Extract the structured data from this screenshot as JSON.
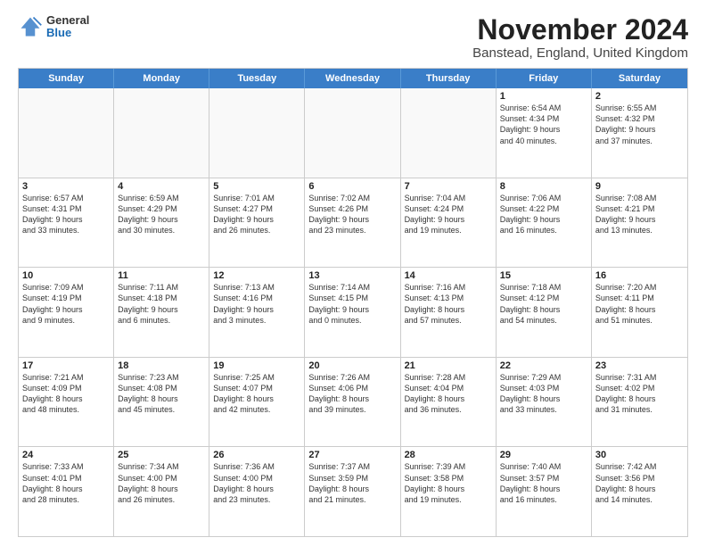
{
  "logo": {
    "general": "General",
    "blue": "Blue"
  },
  "title": "November 2024",
  "location": "Banstead, England, United Kingdom",
  "header_days": [
    "Sunday",
    "Monday",
    "Tuesday",
    "Wednesday",
    "Thursday",
    "Friday",
    "Saturday"
  ],
  "rows": [
    [
      {
        "day": "",
        "info": "",
        "empty": true
      },
      {
        "day": "",
        "info": "",
        "empty": true
      },
      {
        "day": "",
        "info": "",
        "empty": true
      },
      {
        "day": "",
        "info": "",
        "empty": true
      },
      {
        "day": "",
        "info": "",
        "empty": true
      },
      {
        "day": "1",
        "info": "Sunrise: 6:54 AM\nSunset: 4:34 PM\nDaylight: 9 hours\nand 40 minutes.",
        "empty": false
      },
      {
        "day": "2",
        "info": "Sunrise: 6:55 AM\nSunset: 4:32 PM\nDaylight: 9 hours\nand 37 minutes.",
        "empty": false
      }
    ],
    [
      {
        "day": "3",
        "info": "Sunrise: 6:57 AM\nSunset: 4:31 PM\nDaylight: 9 hours\nand 33 minutes.",
        "empty": false
      },
      {
        "day": "4",
        "info": "Sunrise: 6:59 AM\nSunset: 4:29 PM\nDaylight: 9 hours\nand 30 minutes.",
        "empty": false
      },
      {
        "day": "5",
        "info": "Sunrise: 7:01 AM\nSunset: 4:27 PM\nDaylight: 9 hours\nand 26 minutes.",
        "empty": false
      },
      {
        "day": "6",
        "info": "Sunrise: 7:02 AM\nSunset: 4:26 PM\nDaylight: 9 hours\nand 23 minutes.",
        "empty": false
      },
      {
        "day": "7",
        "info": "Sunrise: 7:04 AM\nSunset: 4:24 PM\nDaylight: 9 hours\nand 19 minutes.",
        "empty": false
      },
      {
        "day": "8",
        "info": "Sunrise: 7:06 AM\nSunset: 4:22 PM\nDaylight: 9 hours\nand 16 minutes.",
        "empty": false
      },
      {
        "day": "9",
        "info": "Sunrise: 7:08 AM\nSunset: 4:21 PM\nDaylight: 9 hours\nand 13 minutes.",
        "empty": false
      }
    ],
    [
      {
        "day": "10",
        "info": "Sunrise: 7:09 AM\nSunset: 4:19 PM\nDaylight: 9 hours\nand 9 minutes.",
        "empty": false
      },
      {
        "day": "11",
        "info": "Sunrise: 7:11 AM\nSunset: 4:18 PM\nDaylight: 9 hours\nand 6 minutes.",
        "empty": false
      },
      {
        "day": "12",
        "info": "Sunrise: 7:13 AM\nSunset: 4:16 PM\nDaylight: 9 hours\nand 3 minutes.",
        "empty": false
      },
      {
        "day": "13",
        "info": "Sunrise: 7:14 AM\nSunset: 4:15 PM\nDaylight: 9 hours\nand 0 minutes.",
        "empty": false
      },
      {
        "day": "14",
        "info": "Sunrise: 7:16 AM\nSunset: 4:13 PM\nDaylight: 8 hours\nand 57 minutes.",
        "empty": false
      },
      {
        "day": "15",
        "info": "Sunrise: 7:18 AM\nSunset: 4:12 PM\nDaylight: 8 hours\nand 54 minutes.",
        "empty": false
      },
      {
        "day": "16",
        "info": "Sunrise: 7:20 AM\nSunset: 4:11 PM\nDaylight: 8 hours\nand 51 minutes.",
        "empty": false
      }
    ],
    [
      {
        "day": "17",
        "info": "Sunrise: 7:21 AM\nSunset: 4:09 PM\nDaylight: 8 hours\nand 48 minutes.",
        "empty": false
      },
      {
        "day": "18",
        "info": "Sunrise: 7:23 AM\nSunset: 4:08 PM\nDaylight: 8 hours\nand 45 minutes.",
        "empty": false
      },
      {
        "day": "19",
        "info": "Sunrise: 7:25 AM\nSunset: 4:07 PM\nDaylight: 8 hours\nand 42 minutes.",
        "empty": false
      },
      {
        "day": "20",
        "info": "Sunrise: 7:26 AM\nSunset: 4:06 PM\nDaylight: 8 hours\nand 39 minutes.",
        "empty": false
      },
      {
        "day": "21",
        "info": "Sunrise: 7:28 AM\nSunset: 4:04 PM\nDaylight: 8 hours\nand 36 minutes.",
        "empty": false
      },
      {
        "day": "22",
        "info": "Sunrise: 7:29 AM\nSunset: 4:03 PM\nDaylight: 8 hours\nand 33 minutes.",
        "empty": false
      },
      {
        "day": "23",
        "info": "Sunrise: 7:31 AM\nSunset: 4:02 PM\nDaylight: 8 hours\nand 31 minutes.",
        "empty": false
      }
    ],
    [
      {
        "day": "24",
        "info": "Sunrise: 7:33 AM\nSunset: 4:01 PM\nDaylight: 8 hours\nand 28 minutes.",
        "empty": false
      },
      {
        "day": "25",
        "info": "Sunrise: 7:34 AM\nSunset: 4:00 PM\nDaylight: 8 hours\nand 26 minutes.",
        "empty": false
      },
      {
        "day": "26",
        "info": "Sunrise: 7:36 AM\nSunset: 4:00 PM\nDaylight: 8 hours\nand 23 minutes.",
        "empty": false
      },
      {
        "day": "27",
        "info": "Sunrise: 7:37 AM\nSunset: 3:59 PM\nDaylight: 8 hours\nand 21 minutes.",
        "empty": false
      },
      {
        "day": "28",
        "info": "Sunrise: 7:39 AM\nSunset: 3:58 PM\nDaylight: 8 hours\nand 19 minutes.",
        "empty": false
      },
      {
        "day": "29",
        "info": "Sunrise: 7:40 AM\nSunset: 3:57 PM\nDaylight: 8 hours\nand 16 minutes.",
        "empty": false
      },
      {
        "day": "30",
        "info": "Sunrise: 7:42 AM\nSunset: 3:56 PM\nDaylight: 8 hours\nand 14 minutes.",
        "empty": false
      }
    ]
  ]
}
